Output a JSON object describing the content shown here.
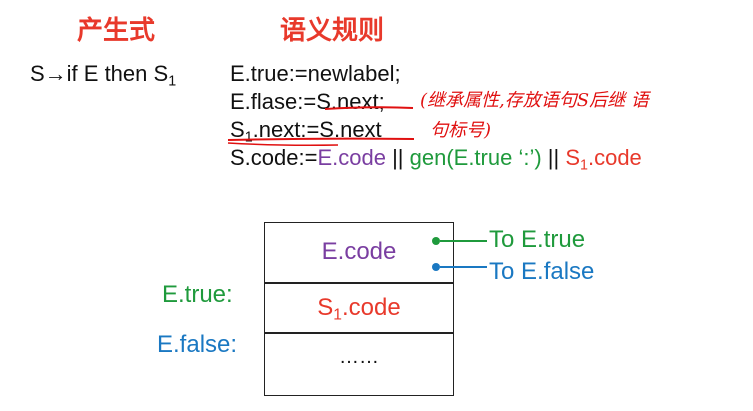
{
  "headers": {
    "production": "产生式",
    "semantic_rules": "语义规则"
  },
  "production": {
    "lhs": "S→if E then S",
    "sub": "1"
  },
  "rules": {
    "line1": "E.true:=newlabel;",
    "line2_prefix": "E.flase:=",
    "line2_snext": "S.next;",
    "line3_a": "S",
    "line3_sub": "1",
    "line3_b": ".next:=S.next",
    "line4_prefix": "S.code:=",
    "line4_ecode": "E.code",
    "line4_pipe1": " || ",
    "line4_gen": "gen(E.true ‘:’)",
    "line4_pipe2": " || ",
    "line4_s": "S",
    "line4_sub": "1",
    "line4_code": ".code"
  },
  "annotation": {
    "line1": "(继承属性,存放语句S后继 语",
    "line2": "句标号)"
  },
  "diagram": {
    "cell1": "E.code",
    "cell2_s": "S",
    "cell2_sub": "1",
    "cell2_code": ".code",
    "cell3": "……",
    "label_true": "E.true:",
    "label_false": "E.false:",
    "arrow_true": "To E.true",
    "arrow_false": "To E.false"
  },
  "colors": {
    "red": "#e8392b",
    "purple": "#7a3ea1",
    "green": "#1f9a3c",
    "blue": "#1a78c2",
    "dark": "#111111"
  }
}
